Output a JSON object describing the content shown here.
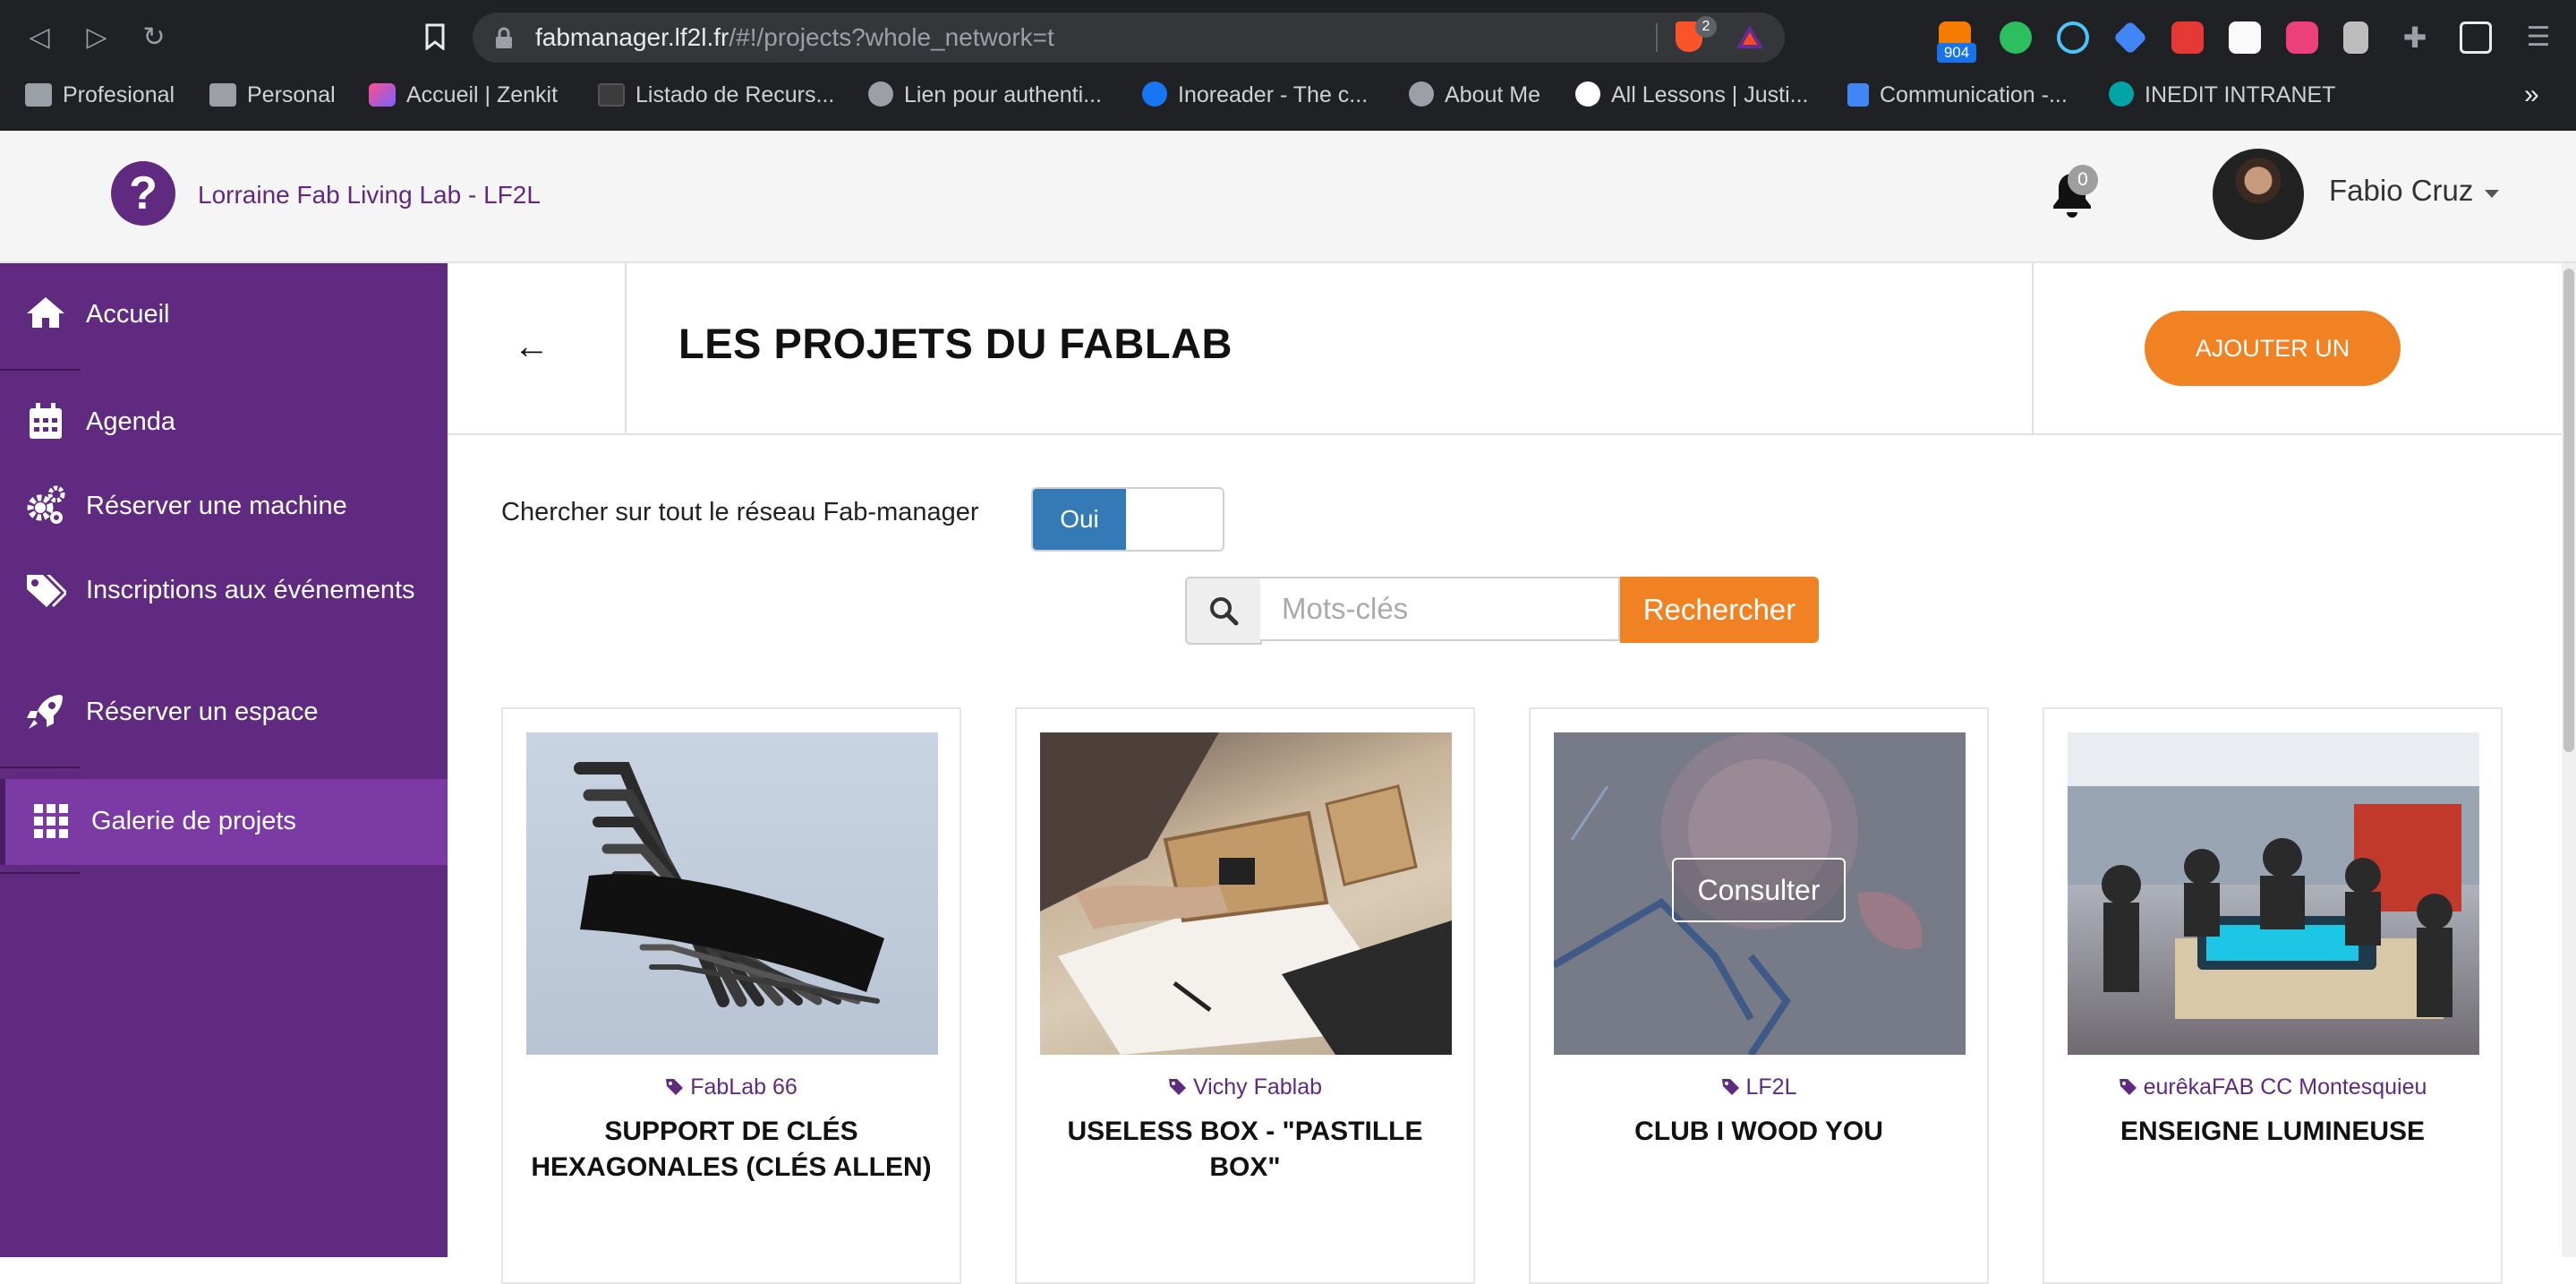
{
  "browser": {
    "url_host": "fabmanager.lf2l.fr",
    "url_path": "/#!/projects?whole_network=t",
    "shield_count": "2",
    "rss_count": "904",
    "bookmarks": [
      {
        "label": "Profesional",
        "icon": "folder-icon"
      },
      {
        "label": "Personal",
        "icon": "folder-icon"
      },
      {
        "label": "Accueil | Zenkit",
        "icon": "zenkit-icon"
      },
      {
        "label": "Listado de Recurs...",
        "icon": "bookmark-file-icon"
      },
      {
        "label": "Lien pour authenti...",
        "icon": "globe-icon"
      },
      {
        "label": "Inoreader - The c...",
        "icon": "inoreader-icon"
      },
      {
        "label": "About Me",
        "icon": "globe-icon"
      },
      {
        "label": "All Lessons | Justi...",
        "icon": "lessons-icon"
      },
      {
        "label": "Communication -...",
        "icon": "docs-icon"
      },
      {
        "label": "INEDIT INTRANET",
        "icon": "intranet-icon"
      }
    ],
    "overflow": "»"
  },
  "header": {
    "org_name": "Lorraine Fab Living Lab - LF2L",
    "logo_glyph": "?",
    "notification_count": "0",
    "user_name": "Fabio Cruz"
  },
  "sidebar": {
    "items": [
      {
        "label": "Accueil",
        "icon": "home-icon"
      },
      {
        "label": "Agenda",
        "icon": "calendar-icon"
      },
      {
        "label": "Réserver une machine",
        "icon": "cogs-icon"
      },
      {
        "label": "Inscriptions aux événements",
        "icon": "tags-icon"
      },
      {
        "label": "Réserver un espace",
        "icon": "rocket-icon"
      },
      {
        "label": "Galerie de projets",
        "icon": "grid-icon",
        "active": true
      }
    ]
  },
  "main": {
    "back_glyph": "←",
    "title": "LES PROJETS DU FABLAB",
    "add_button": "AJOUTER UN PROJET",
    "network_label": "Chercher sur tout le réseau Fab-manager",
    "toggle_value": "Oui",
    "search_placeholder": "Mots-clés",
    "search_button": "Rechercher",
    "projects": [
      {
        "lab": "FabLab 66",
        "title": "SUPPORT DE CLÉS HEXAGONALES (CLÉS ALLEN)"
      },
      {
        "lab": "Vichy Fablab",
        "title": "USELESS BOX - \"PASTILLE BOX\""
      },
      {
        "lab": "LF2L",
        "title": "CLUB I WOOD YOU",
        "hover_label": "Consulter"
      },
      {
        "lab": "eurêkaFAB CC Montesquieu",
        "title": "ENSEIGNE LUMINEUSE"
      }
    ]
  },
  "colors": {
    "brand_purple": "#5f2a7f",
    "active_purple": "#7c3aa4",
    "accent_orange": "#f08223",
    "toggle_blue": "#337ab7"
  }
}
